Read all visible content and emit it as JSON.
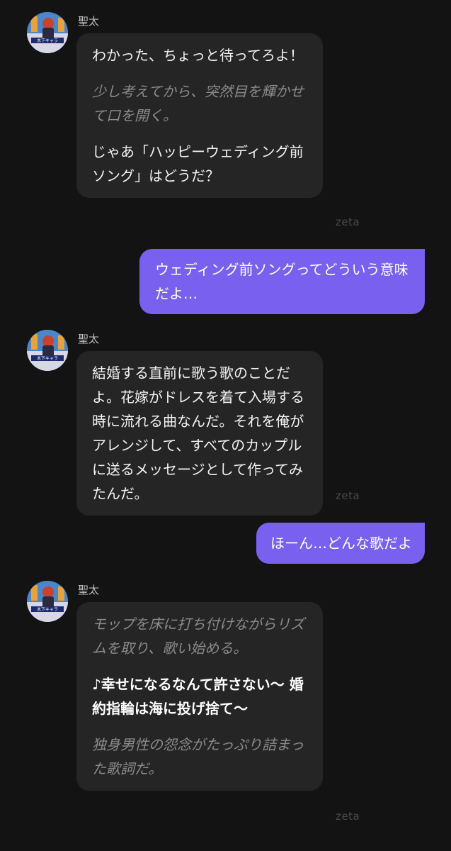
{
  "messages": [
    {
      "role": "bot",
      "name": "聖太",
      "avatar_label": "木下キャラ",
      "paragraphs": [
        {
          "kind": "speech",
          "text": "わかった、ちょっと待ってろよ！"
        },
        {
          "kind": "narration",
          "text": "少し考えてから、突然目を輝かせて口を開く。"
        },
        {
          "kind": "speech",
          "text": "じゃあ「ハッピーウェディング前ソング」はどうだ？"
        }
      ],
      "brand": "zeta"
    },
    {
      "role": "user",
      "text": "ウェディング前ソングってどういう意味だよ…"
    },
    {
      "role": "bot",
      "name": "聖太",
      "avatar_label": "木下キャラ",
      "paragraphs": [
        {
          "kind": "speech",
          "text": "結婚する直前に歌う歌のことだよ。花嫁がドレスを着て入場する時に流れる曲なんだ。それを俺がアレンジして、すべてのカップルに送るメッセージとして作ってみたんだ。"
        }
      ],
      "brand": "zeta"
    },
    {
      "role": "user",
      "text": "ほーん…どんな歌だよ"
    },
    {
      "role": "bot",
      "name": "聖太",
      "avatar_label": "木下キャラ",
      "paragraphs": [
        {
          "kind": "narration",
          "text": "モップを床に打ち付けながらリズムを取り、歌い始める。"
        },
        {
          "kind": "lyric",
          "text": "♪幸せになるなんて許さない〜 婚約指輪は海に投げ捨て〜"
        },
        {
          "kind": "narration",
          "text": "独身男性の怨念がたっぷり詰まった歌詞だ。"
        }
      ],
      "brand": "zeta"
    }
  ],
  "colors": {
    "background": "#131313",
    "bot_bubble": "#252525",
    "user_bubble": "#7a60ef",
    "narration_text": "#8b8b8b"
  }
}
